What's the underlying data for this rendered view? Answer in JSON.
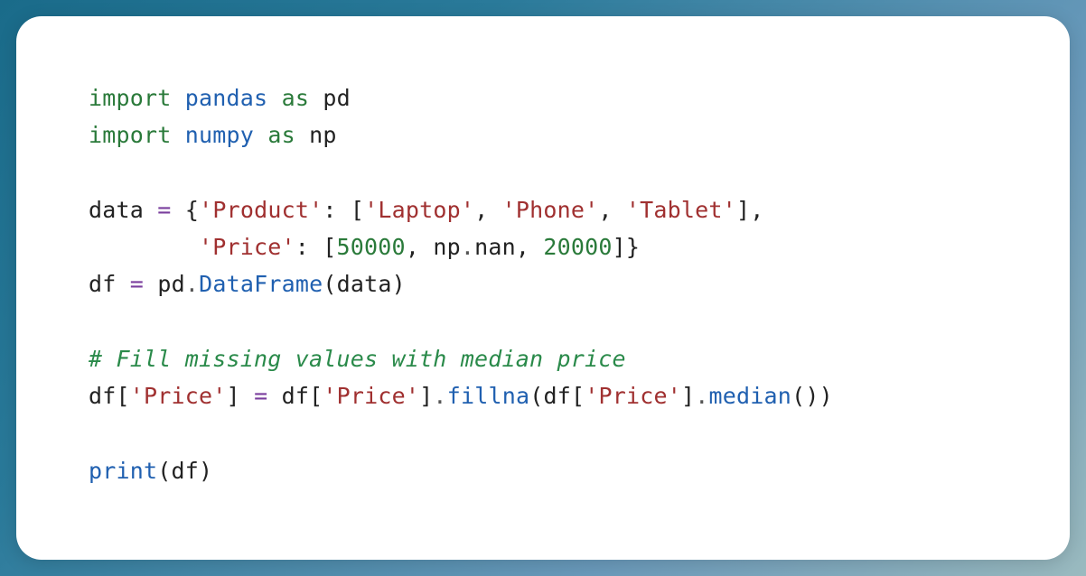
{
  "code": {
    "line1": {
      "kw1": "import",
      "mod": "pandas",
      "kw2": "as",
      "alias": "pd"
    },
    "line2": {
      "kw1": "import",
      "mod": "numpy",
      "kw2": "as",
      "alias": "np"
    },
    "line4": {
      "var": "data",
      "eq": "=",
      "key1": "'Product'",
      "v1a": "'Laptop'",
      "v1b": "'Phone'",
      "v1c": "'Tablet'"
    },
    "line5": {
      "key2": "'Price'",
      "n1": "50000",
      "np": "np",
      "nan": "nan",
      "n2": "20000"
    },
    "line6": {
      "var": "df",
      "eq": "=",
      "pd": "pd",
      "fn": "DataFrame",
      "arg": "data"
    },
    "line8": {
      "comment": "# Fill missing values with median price"
    },
    "line9": {
      "df": "df",
      "k1": "'Price'",
      "eq": "=",
      "df2": "df",
      "k2": "'Price'",
      "fillna": "fillna",
      "df3": "df",
      "k3": "'Price'",
      "median": "median"
    },
    "line11": {
      "print": "print",
      "arg": "df"
    }
  }
}
